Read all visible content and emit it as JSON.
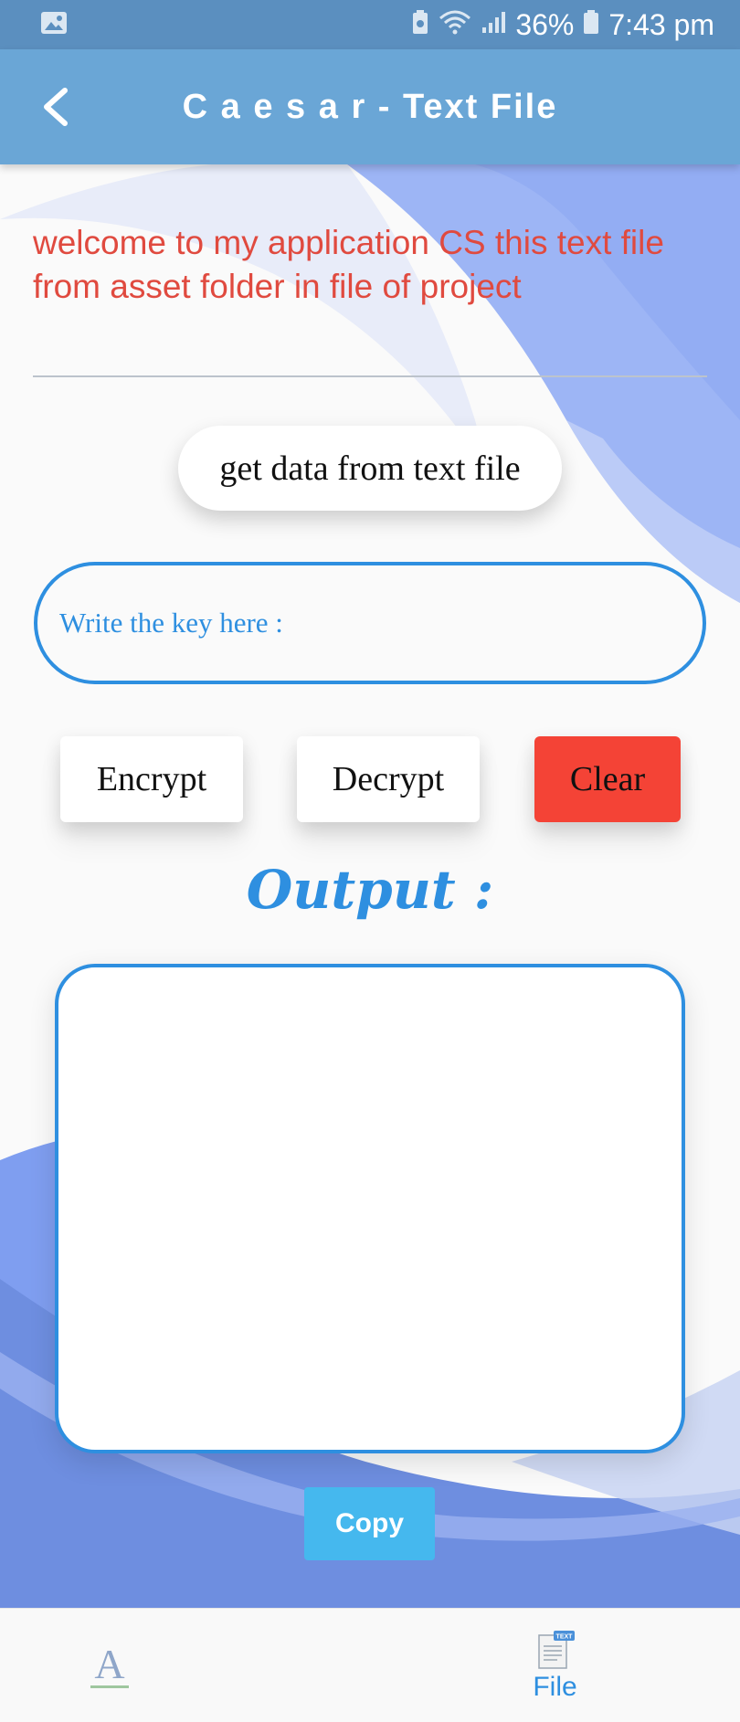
{
  "status_bar": {
    "battery": "36%",
    "time": "7:43 pm"
  },
  "app_bar": {
    "title": "C a e s a r - Text File"
  },
  "main": {
    "welcome_text": "welcome to my application CS  this text file from asset folder in file of project",
    "get_data_label": "get data from text file",
    "key_placeholder": "Write the key here :",
    "key_value": "",
    "encrypt_label": "Encrypt",
    "decrypt_label": "Decrypt",
    "clear_label": "Clear",
    "output_label": "Output :",
    "output_text": "",
    "copy_label": "Copy"
  },
  "bottom_nav": {
    "text_tab_icon": "A",
    "file_tab_label": "File",
    "file_icon_badge": "TEXT"
  },
  "colors": {
    "status_bar": "#5b8fbf",
    "app_bar": "#6aa6d6",
    "accent_blue": "#2e8fe0",
    "welcome_red": "#e04a3f",
    "clear_red": "#f44336",
    "copy_blue": "#45b8ee"
  },
  "icons": {
    "back": "arrow-back-icon",
    "gallery": "image-notification-icon",
    "battery_saver": "battery-saver-icon",
    "wifi": "wifi-icon",
    "signal": "signal-icon",
    "battery": "battery-icon",
    "text_tab": "text-format-icon",
    "file_tab": "text-file-icon"
  }
}
